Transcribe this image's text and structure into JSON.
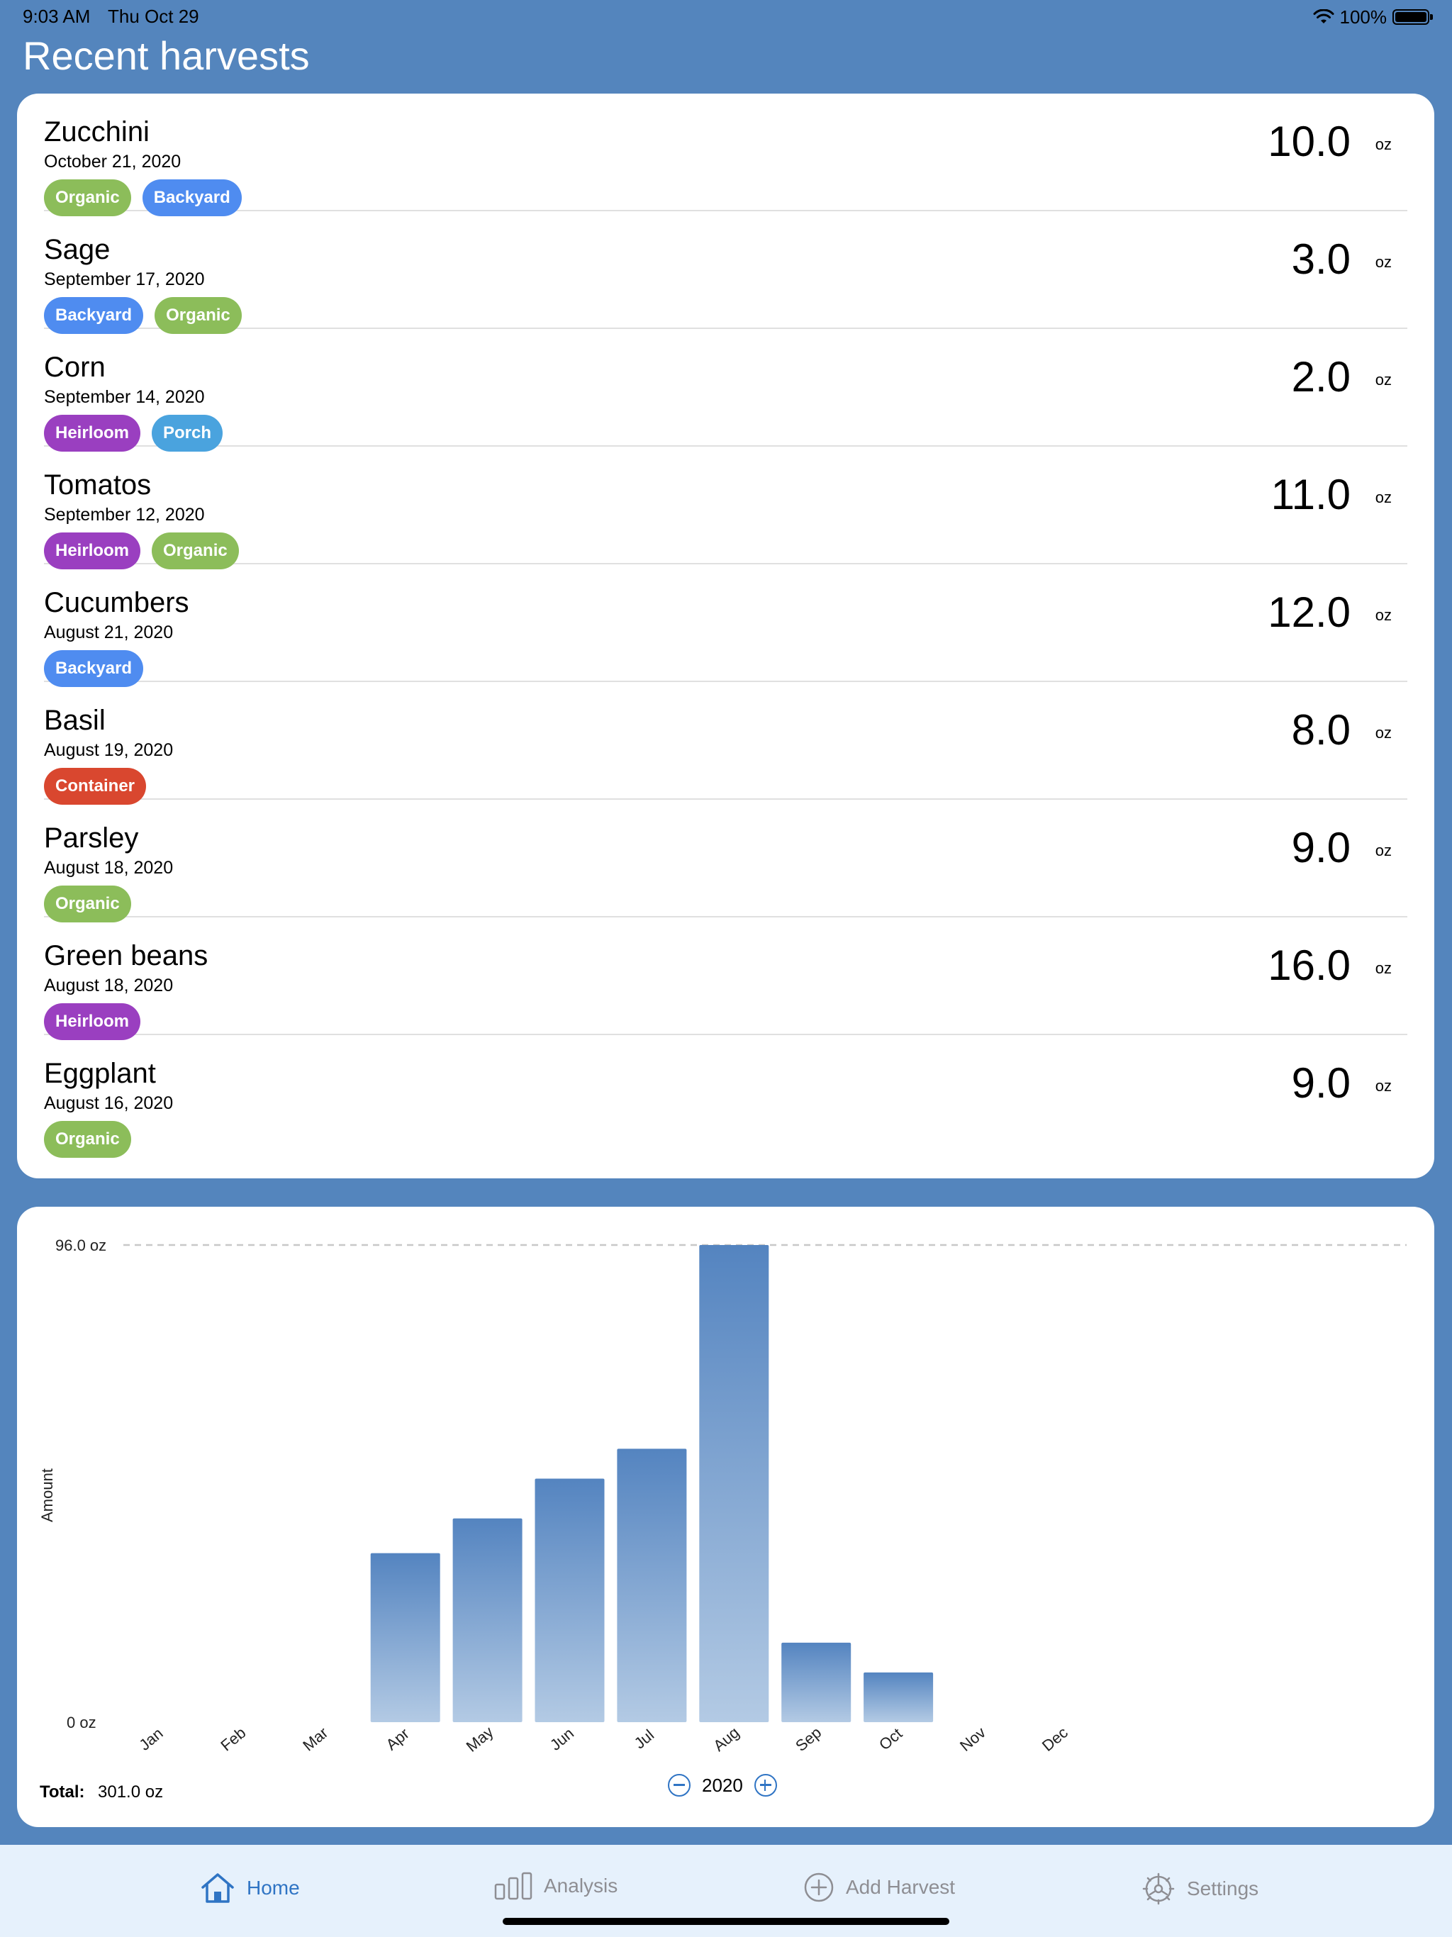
{
  "status": {
    "time": "9:03 AM",
    "date": "Thu Oct 29",
    "battery": "100%"
  },
  "title": "Recent harvests",
  "harvests": [
    {
      "name": "Zucchini",
      "date": "October 21, 2020",
      "amount": "10.0",
      "unit": "oz",
      "tags": [
        "Organic",
        "Backyard"
      ]
    },
    {
      "name": "Sage",
      "date": "September 17, 2020",
      "amount": "3.0",
      "unit": "oz",
      "tags": [
        "Backyard",
        "Organic"
      ]
    },
    {
      "name": "Corn",
      "date": "September 14, 2020",
      "amount": "2.0",
      "unit": "oz",
      "tags": [
        "Heirloom",
        "Porch"
      ]
    },
    {
      "name": "Tomatos",
      "date": "September 12, 2020",
      "amount": "11.0",
      "unit": "oz",
      "tags": [
        "Heirloom",
        "Organic"
      ]
    },
    {
      "name": "Cucumbers",
      "date": "August 21, 2020",
      "amount": "12.0",
      "unit": "oz",
      "tags": [
        "Backyard"
      ]
    },
    {
      "name": "Basil",
      "date": "August 19, 2020",
      "amount": "8.0",
      "unit": "oz",
      "tags": [
        "Container"
      ]
    },
    {
      "name": "Parsley",
      "date": "August 18, 2020",
      "amount": "9.0",
      "unit": "oz",
      "tags": [
        "Organic"
      ]
    },
    {
      "name": "Green beans",
      "date": "August 18, 2020",
      "amount": "16.0",
      "unit": "oz",
      "tags": [
        "Heirloom"
      ]
    },
    {
      "name": "Eggplant",
      "date": "August 16, 2020",
      "amount": "9.0",
      "unit": "oz",
      "tags": [
        "Organic"
      ]
    }
  ],
  "tag_colors": {
    "Organic": "#8cbd5a",
    "Backyard": "#4f8cf0",
    "Heirloom": "#9a3fc0",
    "Porch": "#4aa3de",
    "Container": "#d9472f"
  },
  "chart_data": {
    "type": "bar",
    "categories": [
      "Jan",
      "Feb",
      "Mar",
      "Apr",
      "May",
      "Jun",
      "Jul",
      "Aug",
      "Sep",
      "Oct",
      "Nov",
      "Dec"
    ],
    "values": [
      0,
      0,
      0,
      34,
      41,
      49,
      55,
      96,
      16,
      10,
      0,
      0
    ],
    "ylabel": "Amount",
    "ylim": [
      0,
      96
    ],
    "y_max_label": "96.0 oz",
    "y_min_label": "0 oz",
    "bar_color_top": "#5484c0",
    "bar_color_bottom": "#b3cae4"
  },
  "totals": {
    "label": "Total:",
    "value": "301.0 oz"
  },
  "year": "2020",
  "tabs": [
    {
      "label": "Home",
      "icon": "home-icon",
      "active": true
    },
    {
      "label": "Analysis",
      "icon": "chart-bars-icon",
      "active": false
    },
    {
      "label": "Add Harvest",
      "icon": "plus-circle-icon",
      "active": false
    },
    {
      "label": "Settings",
      "icon": "gear-icon",
      "active": false
    }
  ],
  "colors": {
    "background": "#5485bd",
    "accent": "#2f74c4",
    "tab_bar": "#e6f1fc",
    "inactive_tab": "#8e8e93"
  }
}
